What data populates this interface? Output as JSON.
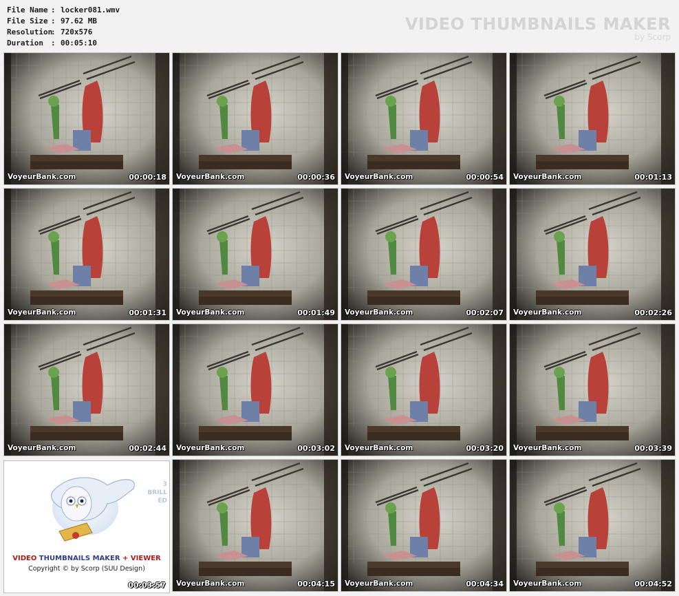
{
  "info": {
    "rows": [
      {
        "label": "File Name",
        "value": "locker081.wmv"
      },
      {
        "label": "File Size",
        "value": "97.62 MB"
      },
      {
        "label": "Resolution",
        "value": "720x576"
      },
      {
        "label": "Duration",
        "value": "00:05:10"
      }
    ]
  },
  "brand": {
    "title": "VIDEO THUMBNAILS MAKER",
    "subtitle": "by Scorp"
  },
  "watermark": "VoyeurBank.com",
  "thumbnails": [
    "00:00:18",
    "00:00:36",
    "00:00:54",
    "00:01:13",
    "00:01:31",
    "00:01:49",
    "00:02:07",
    "00:02:26",
    "00:02:44",
    "00:03:02",
    "00:03:20",
    "00:03:39",
    "00:03:57",
    "00:04:15",
    "00:04:34",
    "00:04:52"
  ],
  "promo": {
    "title_part1": "VIDEO",
    "title_part2": " THUMBNAILS MAKER",
    "title_part3": " + VIEWER",
    "copyright": "Copyright © by Scorp (SUU Design)",
    "side_lines": [
      "3",
      "BRILL",
      "ED"
    ]
  }
}
